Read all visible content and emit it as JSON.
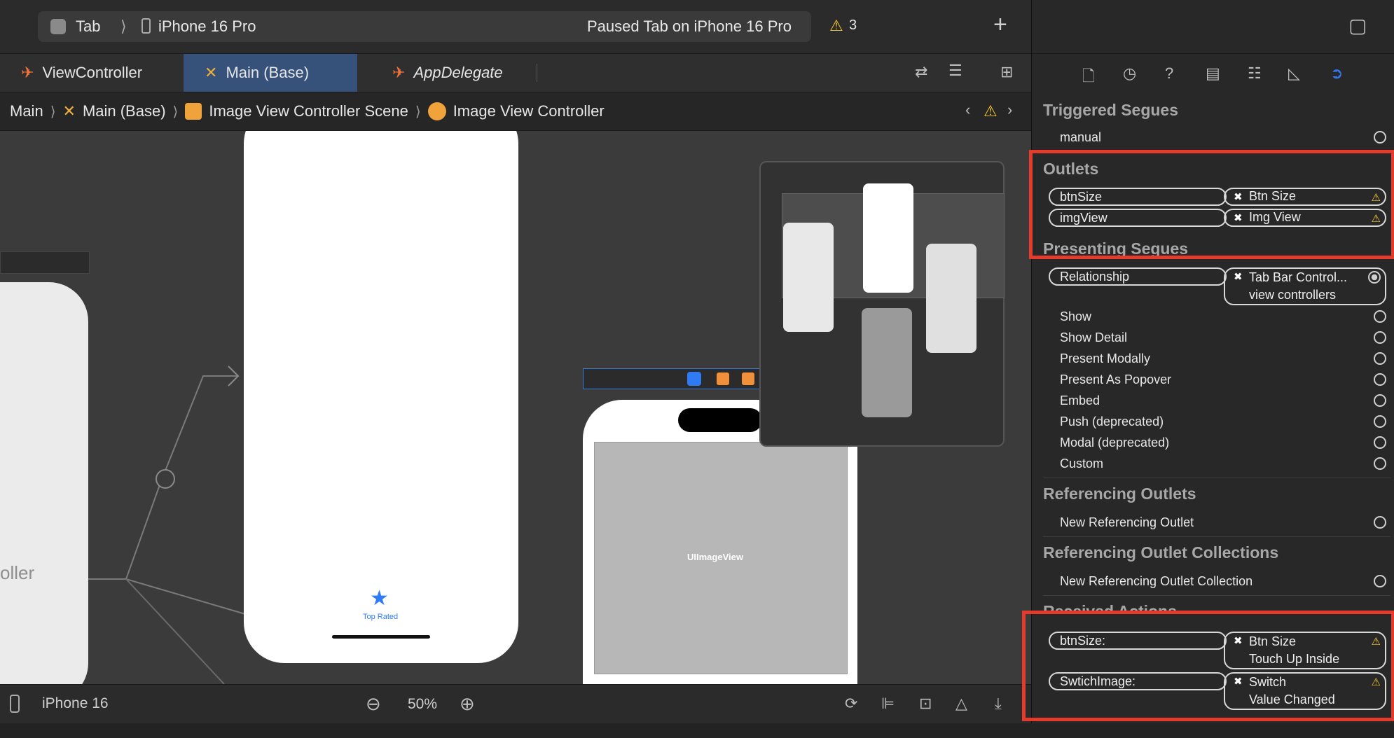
{
  "toolbar": {
    "scheme": "Tab",
    "device": "iPhone 16 Pro",
    "status": "Paused Tab on iPhone 16 Pro",
    "warnings": "3",
    "add": "+"
  },
  "tabs": [
    {
      "label": "ViewController",
      "active": false
    },
    {
      "label": "Main (Base)",
      "active": true
    },
    {
      "label": "AppDelegate",
      "active": false
    }
  ],
  "breadcrumb": [
    "Main",
    "Main (Base)",
    "Image View Controller Scene",
    "Image View Controller"
  ],
  "canvas": {
    "left_label": "oller",
    "tab_item_label": "Top Rated",
    "imageview_label": "UIImageView"
  },
  "bottombar": {
    "device": "iPhone 16",
    "zoom": "50%"
  },
  "inspector": {
    "triggered_segues": {
      "title": "Triggered Segues",
      "items": [
        "manual"
      ]
    },
    "outlets": {
      "title": "Outlets",
      "items": [
        {
          "name": "btnSize",
          "target": "Btn Size"
        },
        {
          "name": "imgView",
          "target": "Img View"
        }
      ]
    },
    "presenting_segues": {
      "title": "Presenting Segues",
      "relationship": {
        "name": "Relationship",
        "target": "Tab Bar Control...",
        "target2": "view controllers"
      },
      "items": [
        "Show",
        "Show Detail",
        "Present Modally",
        "Present As Popover",
        "Embed",
        "Push (deprecated)",
        "Modal (deprecated)",
        "Custom"
      ]
    },
    "referencing_outlets": {
      "title": "Referencing Outlets",
      "items": [
        "New Referencing Outlet"
      ]
    },
    "referencing_outlet_collections": {
      "title": "Referencing Outlet Collections",
      "items": [
        "New Referencing Outlet Collection"
      ]
    },
    "received_actions": {
      "title": "Received Actions",
      "items": [
        {
          "name": "btnSize:",
          "target": "Btn Size",
          "event": "Touch Up Inside"
        },
        {
          "name": "SwtichImage:",
          "target": "Switch",
          "event": "Value Changed"
        }
      ]
    }
  },
  "colors": {
    "highlight": "#e53b2c",
    "accent": "#2f7bf5",
    "warning": "#f4c430"
  }
}
